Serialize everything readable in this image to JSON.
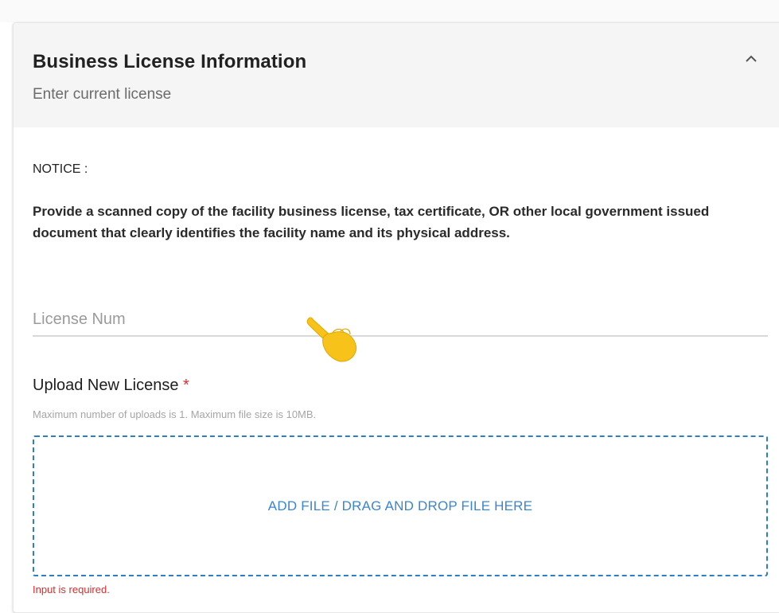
{
  "section": {
    "title": "Business License Information",
    "subtitle": "Enter current license",
    "collapse_icon": "chevron-up-icon"
  },
  "notice": {
    "label": "NOTICE :",
    "text": "Provide a scanned copy of the facility business license, tax certificate, OR other local government issued document that clearly identifies the facility name and its physical address."
  },
  "license_field": {
    "placeholder": "License Num",
    "value": ""
  },
  "upload": {
    "label": "Upload New License",
    "required_marker": "*",
    "hint": "Maximum number of uploads is 1. Maximum file size is 10MB.",
    "dropzone_text": "ADD FILE / DRAG AND DROP FILE HERE",
    "error": "Input is required."
  },
  "cursor": {
    "icon": "pointing-hand-cursor-icon"
  },
  "colors": {
    "accent": "#2d7fc4",
    "error": "#d32f2f",
    "header_bg": "#f5f5f5",
    "cursor": "#f7c31a"
  }
}
